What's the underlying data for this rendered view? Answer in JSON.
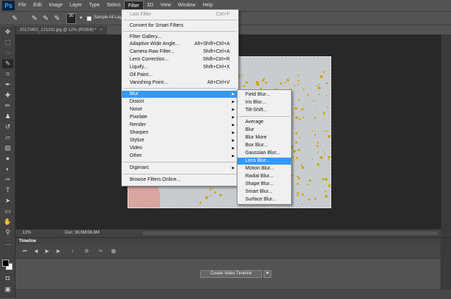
{
  "app": {
    "logo": "Ps"
  },
  "menubar": [
    "File",
    "Edit",
    "Image",
    "Layer",
    "Type",
    "Select",
    "Filter",
    "3D",
    "View",
    "Window",
    "Help"
  ],
  "options_bar": {
    "brush_size": "30",
    "sample_label": "Sample All Layers"
  },
  "document": {
    "tab_title": "20170402_121232.jpg @ 12% (RGB/8) *",
    "close": "×"
  },
  "status": {
    "zoom": "12%",
    "doc_info": "Doc: 36.6M/36.6M"
  },
  "timeline": {
    "tab": "Timeline",
    "create_button": "Create Video Timeline"
  },
  "filter_menu": {
    "last_filter": {
      "label": "Last Filter",
      "shortcut": "Ctrl+F"
    },
    "convert": "Convert for Smart Filters",
    "group2": [
      {
        "label": "Filter Gallery...",
        "shortcut": ""
      },
      {
        "label": "Adaptive Wide Angle...",
        "shortcut": "Alt+Shift+Ctrl+A"
      },
      {
        "label": "Camera Raw Filter...",
        "shortcut": "Shift+Ctrl+A"
      },
      {
        "label": "Lens Correction...",
        "shortcut": "Shift+Ctrl+R"
      },
      {
        "label": "Liquify...",
        "shortcut": "Shift+Ctrl+X"
      },
      {
        "label": "Oil Paint...",
        "shortcut": ""
      },
      {
        "label": "Vanishing Point...",
        "shortcut": "Alt+Ctrl+V"
      }
    ],
    "submenus": [
      "Blur",
      "Distort",
      "Noise",
      "Pixelate",
      "Render",
      "Sharpen",
      "Stylize",
      "Video",
      "Other"
    ],
    "digimarc": "Digimarc",
    "browse": "Browse Filters Online..."
  },
  "blur_submenu": {
    "group1": [
      "Field Blur...",
      "Iris Blur...",
      "Tilt-Shift..."
    ],
    "group2": [
      "Average",
      "Blur",
      "Blur More",
      "Box Blur...",
      "Gaussian Blur...",
      "Lens Blur...",
      "Motion Blur...",
      "Radial Blur...",
      "Shape Blur...",
      "Smart Blur...",
      "Surface Blur..."
    ]
  },
  "colors": {
    "highlight": "#3399ff",
    "glitter": "#c9a80e"
  }
}
